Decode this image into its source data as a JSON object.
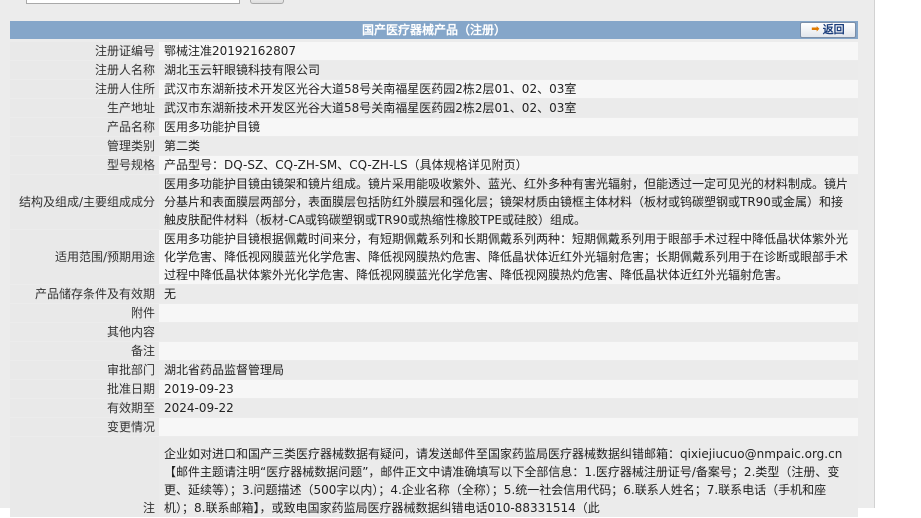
{
  "header": {
    "title": "国产医疗器械产品（注册）",
    "back_label": "返回"
  },
  "fields": [
    {
      "label": "注册证编号",
      "value": "鄂械注准20192162807"
    },
    {
      "label": "注册人名称",
      "value": "湖北玉云轩眼镜科技有限公司"
    },
    {
      "label": "注册人住所",
      "value": "武汉市东湖新技术开发区光谷大道58号关南福星医药园2栋2层01、02、03室"
    },
    {
      "label": "生产地址",
      "value": "武汉市东湖新技术开发区光谷大道58号关南福星医药园2栋2层01、02、03室"
    },
    {
      "label": "产品名称",
      "value": "医用多功能护目镜"
    },
    {
      "label": "管理类别",
      "value": "第二类"
    },
    {
      "label": "型号规格",
      "value": "产品型号：DQ-SZ、CQ-ZH-SM、CQ-ZH-LS（具体规格详见附页）"
    },
    {
      "label": "结构及组成/主要组成成分",
      "value": "医用多功能护目镜由镜架和镜片组成。镜片采用能吸收紫外、蓝光、红外多种有害光辐射，但能透过一定可见光的材料制成。镜片分基片和表面膜层两部分，表面膜层包括防红外膜层和强化层；镜架材质由镜框主体材料（板材或钨碳塑钢或TR90或金属）和接触皮肤配件材料（板材-CA或钨碳塑钢或TR90或热缩性橡胶TPE或硅胶）组成。"
    },
    {
      "label": "适用范围/预期用途",
      "value": "医用多功能护目镜根据佩戴时间来分，有短期佩戴系列和长期佩戴系列两种：短期佩戴系列用于眼部手术过程中降低晶状体紫外光化学危害、降低视网膜蓝光化学危害、降低视网膜热灼危害、降低晶状体近红外光辐射危害；长期佩戴系列用于在诊断或眼部手术过程中降低晶状体紫外光化学危害、降低视网膜蓝光化学危害、降低视网膜热灼危害、降低晶状体近红外光辐射危害。"
    },
    {
      "label": "产品储存条件及有效期",
      "value": "无"
    },
    {
      "label": "附件",
      "value": ""
    },
    {
      "label": "其他内容",
      "value": ""
    },
    {
      "label": "备注",
      "value": ""
    },
    {
      "label": "审批部门",
      "value": "湖北省药品监督管理局"
    },
    {
      "label": "批准日期",
      "value": "2019-09-23"
    },
    {
      "label": "有效期至",
      "value": "2024-09-22"
    },
    {
      "label": "变更情况",
      "value": ""
    },
    {
      "label": "注",
      "value": "企业如对进口和国产三类医疗器械数据有疑问，请发送邮件至国家药监局医疗器械数据纠错邮箱：qixiejiucuo@nmpaic.org.cn【邮件主题请注明“医疗器械数据问题”，邮件正文中请准确填写以下全部信息：1.医疗器械注册证号/备案号；2.类型（注册、变更、延续等）；3.问题描述（500字以内）；4.企业名称（全称）；5.统一社会信用代码；6.联系人姓名；7.联系电话（手机和座机）；8.联系邮箱】，或致电国家药监局医疗器械数据纠错电话010-88331514（此"
    }
  ]
}
